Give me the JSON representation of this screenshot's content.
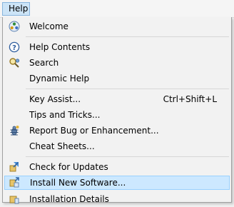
{
  "menubar": {
    "help_label": "Help"
  },
  "menu": {
    "items": [
      {
        "label": "Welcome",
        "icon": "welcome-icon"
      },
      {
        "label": "Help Contents",
        "icon": "help-contents-icon"
      },
      {
        "label": "Search",
        "icon": "search-icon"
      },
      {
        "label": "Dynamic Help",
        "icon": ""
      },
      {
        "label": "Key Assist...",
        "shortcut": "Ctrl+Shift+L",
        "icon": ""
      },
      {
        "label": "Tips and Tricks...",
        "icon": ""
      },
      {
        "label": "Report Bug or Enhancement...",
        "icon": "bug-report-icon"
      },
      {
        "label": "Cheat Sheets...",
        "icon": ""
      },
      {
        "label": "Check for Updates",
        "icon": "update-icon"
      },
      {
        "label": "Install New Software...",
        "icon": "install-software-icon",
        "highlighted": true
      },
      {
        "label": "Installation Details",
        "icon": "installation-details-icon"
      }
    ]
  },
  "colors": {
    "highlight": "#cce8ff",
    "highlight_border": "#99d1ff",
    "menubar_active": "#cce4f7"
  }
}
